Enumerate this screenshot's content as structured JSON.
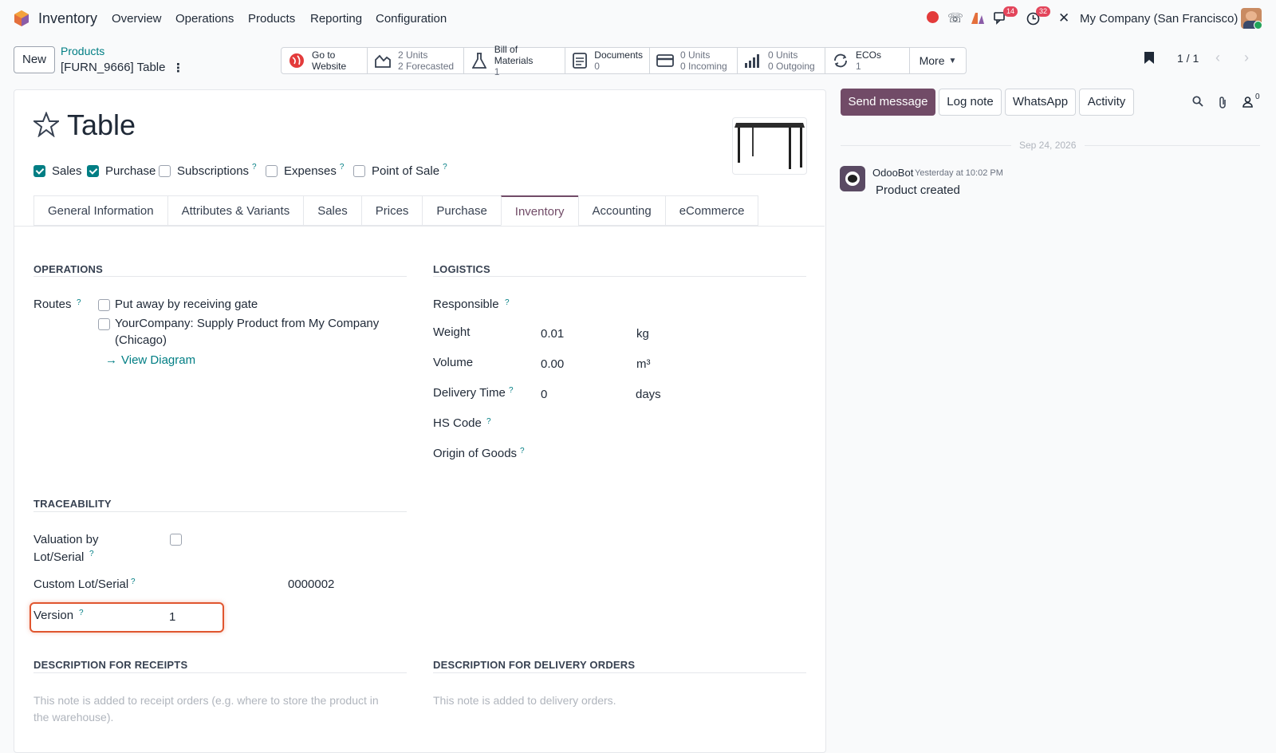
{
  "topbar": {
    "app_name": "Inventory",
    "menu": [
      "Overview",
      "Operations",
      "Products",
      "Reporting",
      "Configuration"
    ],
    "messages_badge": "14",
    "activity_badge": "32",
    "company": "My Company (San Francisco)"
  },
  "control": {
    "new_label": "New",
    "breadcrumb_parent": "Products",
    "breadcrumb_current": "[FURN_9666] Table",
    "pager": "1 / 1"
  },
  "smart_buttons": [
    {
      "icon": "globe-icon",
      "line1": "Go to",
      "line2": "Website"
    },
    {
      "icon": "forecast-chart-icon",
      "line1": "2 Units",
      "line2": "2 Forecasted"
    },
    {
      "icon": "flask-icon",
      "line1": "Bill of Materials",
      "line2": "1"
    },
    {
      "icon": "document-icon",
      "line1": "Documents",
      "line2": "0"
    },
    {
      "icon": "incoming-icon",
      "line1": "0 Units",
      "line2": "0 Incoming"
    },
    {
      "icon": "bar-chart-icon",
      "line1": "0 Units",
      "line2": "0 Outgoing"
    },
    {
      "icon": "eco-cycle-icon",
      "line1": "ECOs",
      "line2": "1"
    }
  ],
  "more_label": "More",
  "product": {
    "name": "Table",
    "flags": [
      {
        "label": "Sales",
        "checked": true,
        "help": false
      },
      {
        "label": "Purchase",
        "checked": true,
        "help": false
      },
      {
        "label": "Subscriptions",
        "checked": false,
        "help": true
      },
      {
        "label": "Expenses",
        "checked": false,
        "help": true
      },
      {
        "label": "Point of Sale",
        "checked": false,
        "help": true
      }
    ]
  },
  "tabs": [
    "General Information",
    "Attributes & Variants",
    "Sales",
    "Prices",
    "Purchase",
    "Inventory",
    "Accounting",
    "eCommerce"
  ],
  "active_tab": "Inventory",
  "operations": {
    "heading": "OPERATIONS",
    "routes_label": "Routes",
    "routes": [
      {
        "label": "Put away by receiving gate",
        "checked": false
      },
      {
        "label_line1": "YourCompany: Supply Product from My Company",
        "label_line2": "(Chicago)",
        "checked": false
      }
    ],
    "view_diagram": "View Diagram"
  },
  "logistics": {
    "heading": "LOGISTICS",
    "responsible_label": "Responsible",
    "weight_label": "Weight",
    "weight_value": "0.01",
    "weight_unit": "kg",
    "volume_label": "Volume",
    "volume_value": "0.00",
    "volume_unit": "m³",
    "delivery_label": "Delivery Time",
    "delivery_value": "0",
    "delivery_unit": "days",
    "hs_code_label": "HS Code",
    "origin_label": "Origin of Goods"
  },
  "traceability": {
    "heading": "TRACEABILITY",
    "valuation_label_1": "Valuation by",
    "valuation_label_2": "Lot/Serial",
    "custom_lot_label": "Custom Lot/Serial",
    "custom_lot_value": "0000002",
    "version_label": "Version",
    "version_value": "1"
  },
  "descriptions": {
    "receipts_heading": "DESCRIPTION FOR RECEIPTS",
    "receipts_placeholder": "This note is added to receipt orders (e.g. where to store the product in the warehouse).",
    "delivery_heading": "DESCRIPTION FOR DELIVERY ORDERS",
    "delivery_placeholder": "This note is added to delivery orders."
  },
  "chatter": {
    "send_message": "Send message",
    "log_note": "Log note",
    "whatsapp": "WhatsApp",
    "activity": "Activity",
    "followers_count": "0",
    "date": "Sep 24, 2026",
    "author": "OdooBot",
    "time": "Yesterday at 10:02 PM",
    "message": "Product created"
  }
}
